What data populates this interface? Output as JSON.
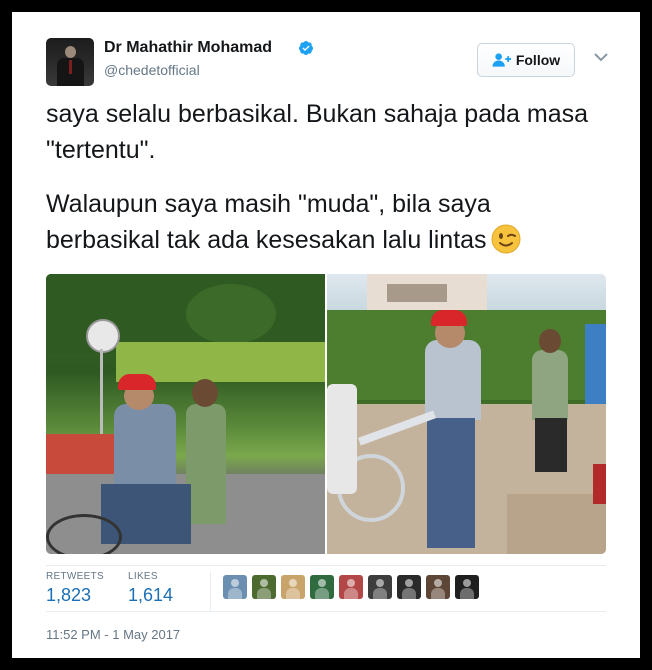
{
  "user": {
    "name": "Dr Mahathir Mohamad",
    "handle": "@chedetofficial",
    "verified": true
  },
  "follow_button": {
    "label": "Follow",
    "icon": "add-user-icon"
  },
  "menu_icon": "chevron-down-icon",
  "tweet": {
    "paragraph1": "saya selalu berbasikal. Bukan sahaja pada masa \"tertentu\".",
    "paragraph2": "Walaupun saya masih \"muda\", bila saya berbasikal tak ada kesesakan lalu lintas",
    "emoji": "winking-face-emoji"
  },
  "media": [
    {
      "icon": "photo-cycling-park"
    },
    {
      "icon": "photo-standing-with-bicycle"
    }
  ],
  "stats": {
    "retweets_label": "RETWEETS",
    "retweets_value": "1,823",
    "likes_label": "LIKES",
    "likes_value": "1,614"
  },
  "likers": [
    {
      "color": "#6a8fb0"
    },
    {
      "color": "#4d6b2f"
    },
    {
      "color": "#c9a46a"
    },
    {
      "color": "#2f6b3f"
    },
    {
      "color": "#b34747"
    },
    {
      "color": "#3d3d3d"
    },
    {
      "color": "#2a2a2a"
    },
    {
      "color": "#5e4636"
    },
    {
      "color": "#1f1f1f"
    }
  ],
  "timestamp": "11:52 PM - 1 May 2017",
  "colors": {
    "text": "#14171a",
    "muted": "#657786",
    "stat_blue": "#1b6fb5",
    "verified_blue": "#1da1f2"
  }
}
